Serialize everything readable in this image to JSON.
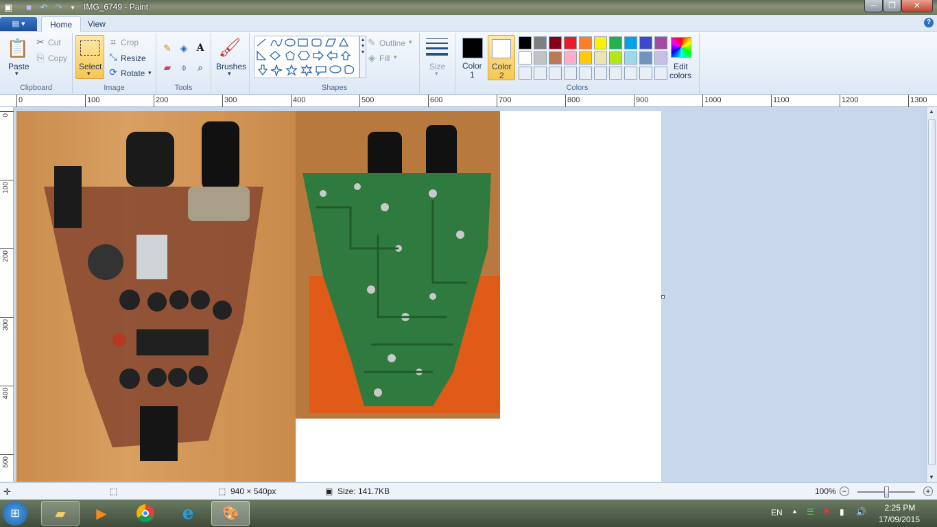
{
  "window": {
    "title": "IMG_6749 - Paint"
  },
  "tabs": [
    {
      "label": "Home"
    },
    {
      "label": "View"
    }
  ],
  "clipboard": {
    "paste": "Paste",
    "cut": "Cut",
    "copy": "Copy",
    "group": "Clipboard"
  },
  "image": {
    "select": "Select",
    "crop": "Crop",
    "resize": "Resize",
    "rotate": "Rotate",
    "group": "Image"
  },
  "tools": {
    "group": "Tools"
  },
  "brushes": {
    "label": "Brushes"
  },
  "shapes": {
    "outline": "Outline",
    "fill": "Fill",
    "group": "Shapes"
  },
  "size": {
    "label": "Size"
  },
  "colors": {
    "color1": "Color\n1",
    "color1_l1": "Color",
    "color1_l2": "1",
    "color2_l1": "Color",
    "color2_l2": "2",
    "edit_l1": "Edit",
    "edit_l2": "colors",
    "group": "Colors",
    "color1_value": "#000000",
    "color2_value": "#ffffff",
    "palette_row1": [
      "#000000",
      "#7f7f7f",
      "#880015",
      "#ed1c24",
      "#ff7f27",
      "#fff200",
      "#22b14c",
      "#00a2e8",
      "#3f48cc",
      "#a349a4"
    ],
    "palette_row2": [
      "#ffffff",
      "#c3c3c3",
      "#b97a57",
      "#ffaec9",
      "#ffc90e",
      "#efe4b0",
      "#b5e61d",
      "#99d9ea",
      "#7092be",
      "#c8bfe7"
    ]
  },
  "ruler": {
    "top": [
      "0",
      "100",
      "200",
      "300",
      "400",
      "500",
      "600",
      "700",
      "800",
      "900",
      "1000",
      "1100",
      "1200",
      "1300"
    ],
    "left": [
      "0",
      "100",
      "200",
      "300",
      "400",
      "500"
    ]
  },
  "status": {
    "dimensions": "940 × 540px",
    "size": "Size: 141.7KB",
    "zoom": "100%"
  },
  "tray": {
    "lang": "EN",
    "time": "2:25 PM",
    "date": "17/09/2015"
  }
}
